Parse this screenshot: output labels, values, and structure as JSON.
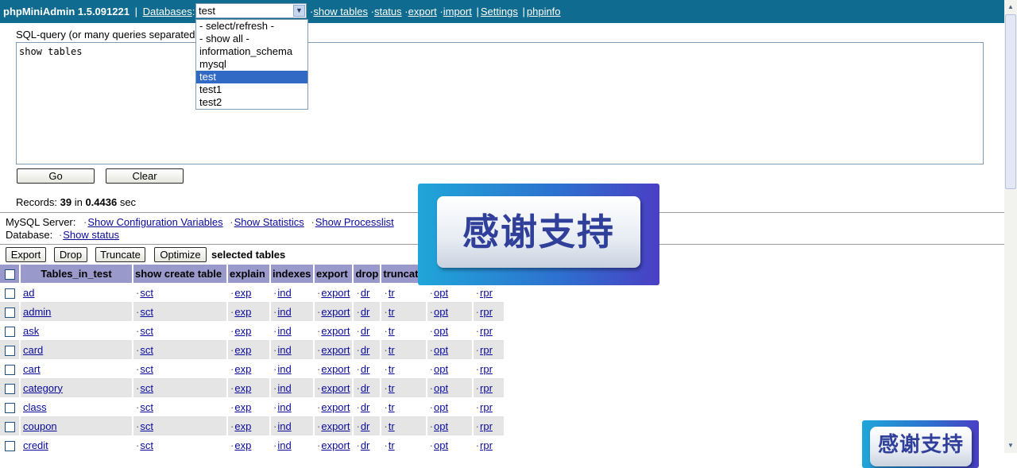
{
  "app": {
    "brand": "phpMiniAdmin 1.5.091221",
    "databases_label": "Databases",
    "selected_db": "test",
    "nav_links": [
      "show tables",
      "status",
      "export",
      "import"
    ],
    "extra_links": [
      "Settings",
      "phpinfo"
    ]
  },
  "dropdown": {
    "options": [
      "- select/refresh -",
      "- show all -",
      "information_schema",
      "mysql",
      "test",
      "test1",
      "test2"
    ],
    "selected_index": 4
  },
  "query": {
    "label": "SQL-query (or many queries separated",
    "value": "show tables",
    "go_label": "Go",
    "clear_label": "Clear"
  },
  "records": {
    "prefix": "Records: ",
    "count": "39",
    "mid": " in ",
    "time": "0.4436",
    "suffix": " sec"
  },
  "server": {
    "label": "MySQL Server:",
    "links": [
      "Show Configuration Variables",
      "Show Statistics",
      "Show Processlist"
    ],
    "db_label": "Database:",
    "db_link": "Show status"
  },
  "actions": {
    "export": "Export",
    "drop": "Drop",
    "truncate": "Truncate",
    "optimize": "Optimize",
    "selected_text": "selected tables"
  },
  "table": {
    "headers": [
      "Tables_in_test",
      "show create table",
      "explain",
      "indexes",
      "export",
      "drop",
      "truncate",
      "",
      "",
      ""
    ],
    "cell_links": [
      "sct",
      "exp",
      "ind",
      "export",
      "dr",
      "tr",
      "opt",
      "rpr"
    ],
    "rows": [
      "ad",
      "admin",
      "ask",
      "card",
      "cart",
      "category",
      "class",
      "coupon",
      "credit"
    ]
  },
  "banner": {
    "text": "感谢支持"
  },
  "colors": {
    "topbar": "#0f6b8f",
    "header_bg": "#9999cc",
    "row_alt": "#e5e5e5",
    "link": "#0a0a9a",
    "selected_option": "#316ac5"
  }
}
